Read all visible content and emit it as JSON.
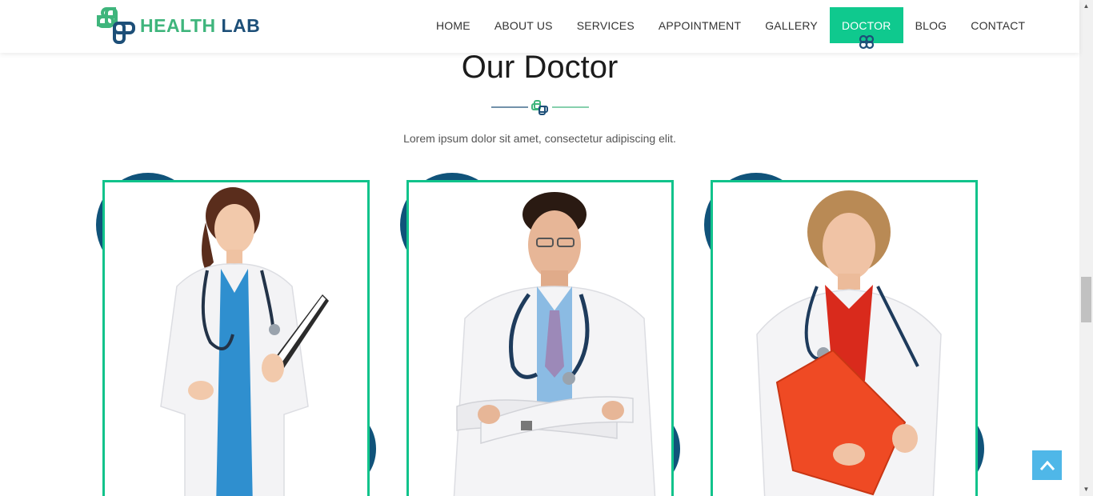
{
  "brand": {
    "part1": "HEALTH",
    "part2": "LAB",
    "logo_icon": "medical-cross-logo-icon"
  },
  "nav": {
    "items": [
      {
        "label": "HOME"
      },
      {
        "label": "ABOUT US"
      },
      {
        "label": "SERVICES"
      },
      {
        "label": "APPOINTMENT"
      },
      {
        "label": "GALLERY"
      },
      {
        "label": "DOCTOR",
        "active": true
      },
      {
        "label": "BLOG"
      },
      {
        "label": "CONTACT"
      }
    ]
  },
  "section": {
    "title": "Our Doctor",
    "subtitle": "Lorem ipsum dolor sit amet, consectetur adipiscing elit."
  },
  "doctors": [
    {
      "image": "female-doctor-with-clipboard"
    },
    {
      "image": "male-doctor-arms-crossed"
    },
    {
      "image": "female-doctor-with-red-folder"
    }
  ],
  "colors": {
    "accent": "#0fc98e",
    "brand_dark": "#10537a",
    "brand_green": "#3fb57c",
    "to_top": "#4fb7e8"
  },
  "to_top": {
    "icon": "chevron-up-icon"
  }
}
